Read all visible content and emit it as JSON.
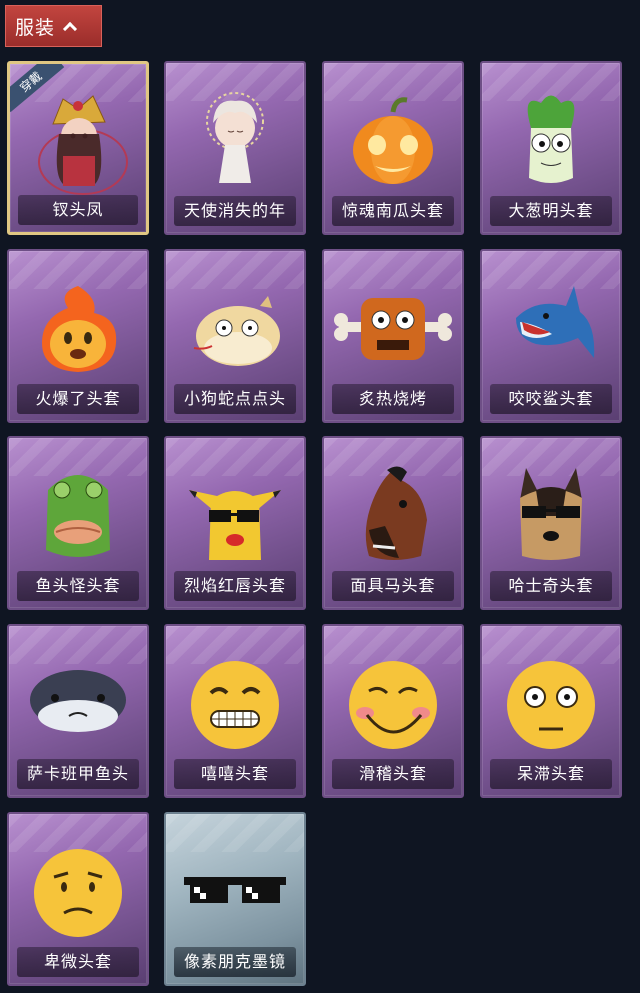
{
  "category_tab": {
    "label": "服装"
  },
  "items": [
    {
      "label": "钗头凤",
      "icon": "phoenix-crown-costume-icon",
      "equipped": true,
      "badge": "穿戴"
    },
    {
      "label": "天使消失的年",
      "icon": "angel-girl-icon"
    },
    {
      "label": "惊魂南瓜头套",
      "icon": "pumpkin-head-icon"
    },
    {
      "label": "大葱明头套",
      "icon": "scallion-head-icon"
    },
    {
      "label": "火爆了头套",
      "icon": "fire-head-icon"
    },
    {
      "label": "小狗蛇点点头",
      "icon": "dog-snake-head-icon"
    },
    {
      "label": "炙热烧烤",
      "icon": "bbq-meat-head-icon"
    },
    {
      "label": "咬咬鲨头套",
      "icon": "shark-head-icon"
    },
    {
      "label": "鱼头怪头套",
      "icon": "fish-monster-head-icon"
    },
    {
      "label": "烈焰红唇头套",
      "icon": "red-lips-pikachu-head-icon"
    },
    {
      "label": "面具马头套",
      "icon": "horse-mask-icon"
    },
    {
      "label": "哈士奇头套",
      "icon": "husky-head-icon"
    },
    {
      "label": "萨卡班甲鱼头",
      "icon": "sacabambaspis-head-icon"
    },
    {
      "label": "嘻嘻头套",
      "icon": "grin-emoji-head-icon"
    },
    {
      "label": "滑稽头套",
      "icon": "funny-emoji-head-icon"
    },
    {
      "label": "呆滞头套",
      "icon": "dazed-emoji-head-icon"
    },
    {
      "label": "卑微头套",
      "icon": "humble-emoji-head-icon"
    },
    {
      "label": "像素朋克墨镜",
      "icon": "pixel-sunglasses-icon"
    }
  ]
}
